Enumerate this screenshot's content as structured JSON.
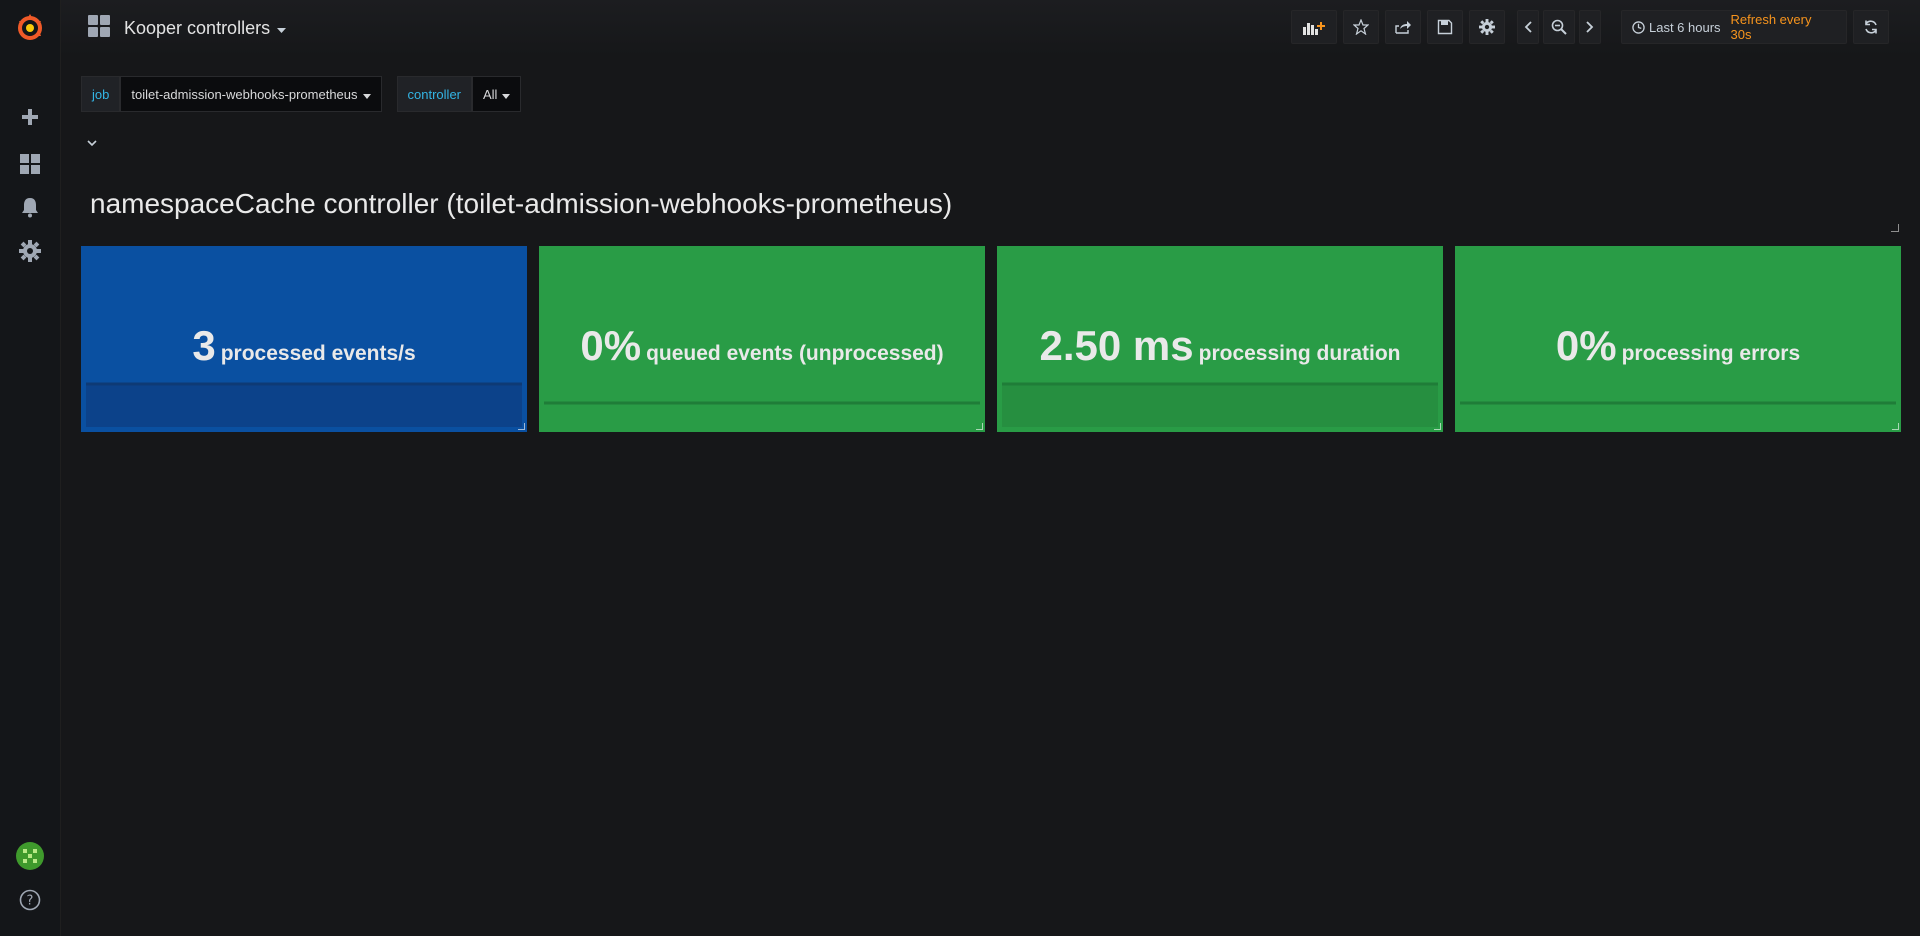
{
  "app": {
    "brand": "Grafana"
  },
  "dashboard": {
    "title": "Kooper controllers"
  },
  "timepicker": {
    "range": "Last 6 hours",
    "refresh": "Refresh every 30s"
  },
  "variables": [
    {
      "label": "job",
      "value": "toilet-admission-webhooks-prometheus"
    },
    {
      "label": "controller",
      "value": "All"
    }
  ],
  "text_panel": {
    "heading": "namespaceCache controller (toilet-admission-webhooks-prometheus)"
  },
  "stats": [
    {
      "value": "3",
      "unit": "processed events/s",
      "color": "#0a50a1",
      "spark": "fill"
    },
    {
      "value": "0%",
      "unit": "queued events (unprocessed)",
      "color": "#299c46",
      "spark": "line"
    },
    {
      "value": "2.50 ms",
      "unit": "processing duration",
      "color": "#299c46",
      "spark": "fill"
    },
    {
      "value": "0%",
      "unit": "processing errors",
      "color": "#299c46",
      "spark": "line"
    }
  ],
  "colors": {
    "accent_blue": "#33b5e5",
    "refresh_orange": "#f7941d",
    "logo_orange": "#f05a28"
  }
}
